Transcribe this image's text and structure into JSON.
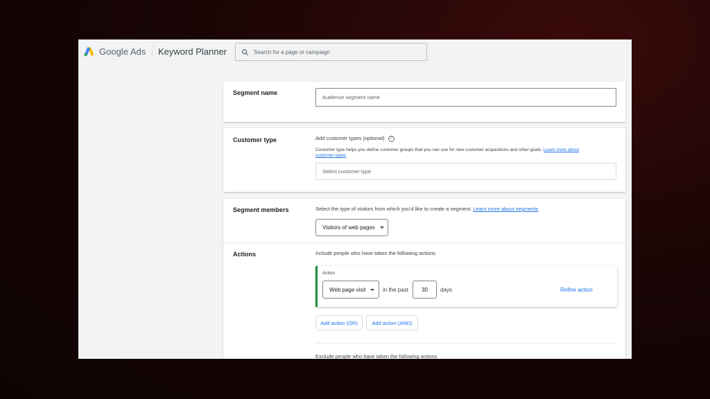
{
  "header": {
    "brand_google": "Google",
    "brand_ads": "Ads",
    "product": "Keyword Planner",
    "search_placeholder": "Search for a page or campaign"
  },
  "segment_name": {
    "label": "Segment name",
    "placeholder": "Audience segment name"
  },
  "customer_type": {
    "label": "Customer type",
    "add_label": "Add customer types (optional)",
    "help_icon": "?",
    "description": "Customer type helps you define customer groups that you can use for new customer acquisitions and other goals.",
    "learn_more_line1": "Learn more about",
    "learn_more_line2": "customer types",
    "select_placeholder": "Select customer type"
  },
  "segment_members": {
    "label": "Segment members",
    "description": "Select the type of visitors from which you'd like to create a segment.",
    "learn_more": "Learn more about segments",
    "dropdown_value": "Visitors of web pages"
  },
  "actions": {
    "label": "Actions",
    "include_text": "Include people who have taken the following actions",
    "action_heading": "Action",
    "action_type": "Web page visit",
    "in_the_past": "in the past",
    "days_value": "30",
    "days_label": "days",
    "refine_action": "Refine action",
    "add_or": "Add action (OR)",
    "add_and": "Add action (AND)",
    "exclude_text": "Exclude people who have taken the following actions"
  },
  "colors": {
    "accent": "#1a73e8",
    "active_border": "#1e8e3e"
  }
}
